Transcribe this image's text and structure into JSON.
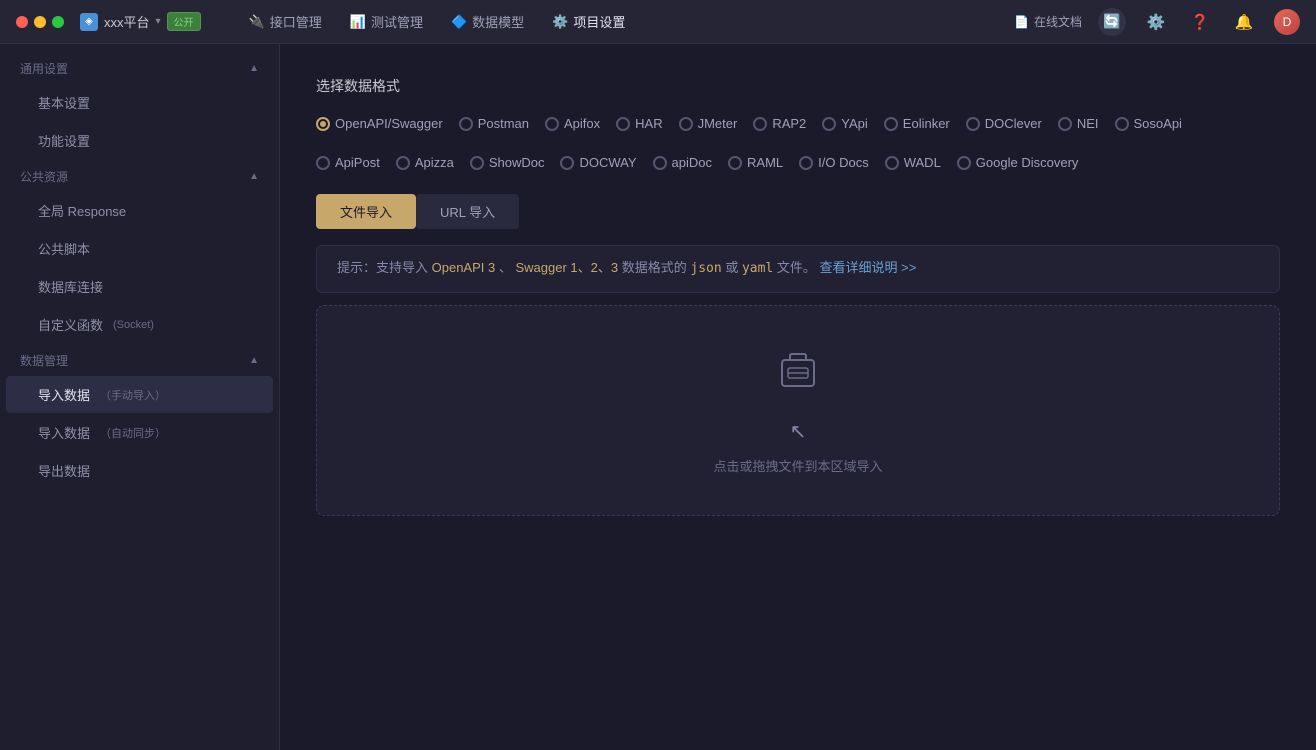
{
  "titlebar": {
    "app_name": "xxx平台",
    "badge": "公开",
    "nav": [
      {
        "label": "接口管理",
        "icon": "🔌"
      },
      {
        "label": "测试管理",
        "icon": "📊"
      },
      {
        "label": "数据模型",
        "icon": "🔷"
      },
      {
        "label": "项目设置",
        "icon": "⚙️"
      }
    ],
    "doc_link": "在线文档",
    "sync_icon": "🔄",
    "settings_icon": "⚙️",
    "help_icon": "❓",
    "bell_icon": "🔔",
    "avatar": "D"
  },
  "sidebar": {
    "sections": [
      {
        "label": "通用设置",
        "items": [
          {
            "label": "基本设置",
            "active": false
          },
          {
            "label": "功能设置",
            "active": false
          }
        ]
      },
      {
        "label": "公共资源",
        "items": [
          {
            "label": "全局 Response",
            "active": false
          },
          {
            "label": "公共脚本",
            "active": false
          },
          {
            "label": "数据库连接",
            "active": false
          },
          {
            "label": "自定义函数",
            "sub": "(Socket)",
            "active": false
          }
        ]
      },
      {
        "label": "数据管理",
        "items": [
          {
            "label": "导入数据",
            "sub": "（手动导入）",
            "active": true
          },
          {
            "label": "导入数据",
            "sub": "（自动同步）",
            "active": false
          },
          {
            "label": "导出数据",
            "active": false
          }
        ]
      }
    ]
  },
  "content": {
    "section_title": "选择数据格式",
    "formats_row1": [
      {
        "label": "OpenAPI/Swagger",
        "checked": true
      },
      {
        "label": "Postman",
        "checked": false
      },
      {
        "label": "Apifox",
        "checked": false
      },
      {
        "label": "HAR",
        "checked": false
      },
      {
        "label": "JMeter",
        "checked": false
      },
      {
        "label": "RAP2",
        "checked": false
      },
      {
        "label": "YApi",
        "checked": false
      },
      {
        "label": "Eolinker",
        "checked": false
      },
      {
        "label": "DOClever",
        "checked": false
      },
      {
        "label": "NEI",
        "checked": false
      },
      {
        "label": "SosoApi",
        "checked": false
      }
    ],
    "formats_row2": [
      {
        "label": "ApiPost",
        "checked": false
      },
      {
        "label": "Apizza",
        "checked": false
      },
      {
        "label": "ShowDoc",
        "checked": false
      },
      {
        "label": "DOCWAY",
        "checked": false
      },
      {
        "label": "apiDoc",
        "checked": false
      },
      {
        "label": "RAML",
        "checked": false
      },
      {
        "label": "I/O Docs",
        "checked": false
      },
      {
        "label": "WADL",
        "checked": false
      },
      {
        "label": "Google Discovery",
        "checked": false
      }
    ],
    "tab_file": "文件导入",
    "tab_url": "URL 导入",
    "hint_prefix": "提示：支持导入",
    "hint_openapi": "OpenAPI 3",
    "hint_sep1": "、",
    "hint_swagger": "Swagger 1、2、3",
    "hint_mid": "数据格式的",
    "hint_json": "json",
    "hint_or": "或",
    "hint_yaml": "yaml",
    "hint_suffix": "文件。",
    "hint_link": "查看详细说明 >>",
    "drop_text": "点击或拖拽文件到本区域导入"
  }
}
